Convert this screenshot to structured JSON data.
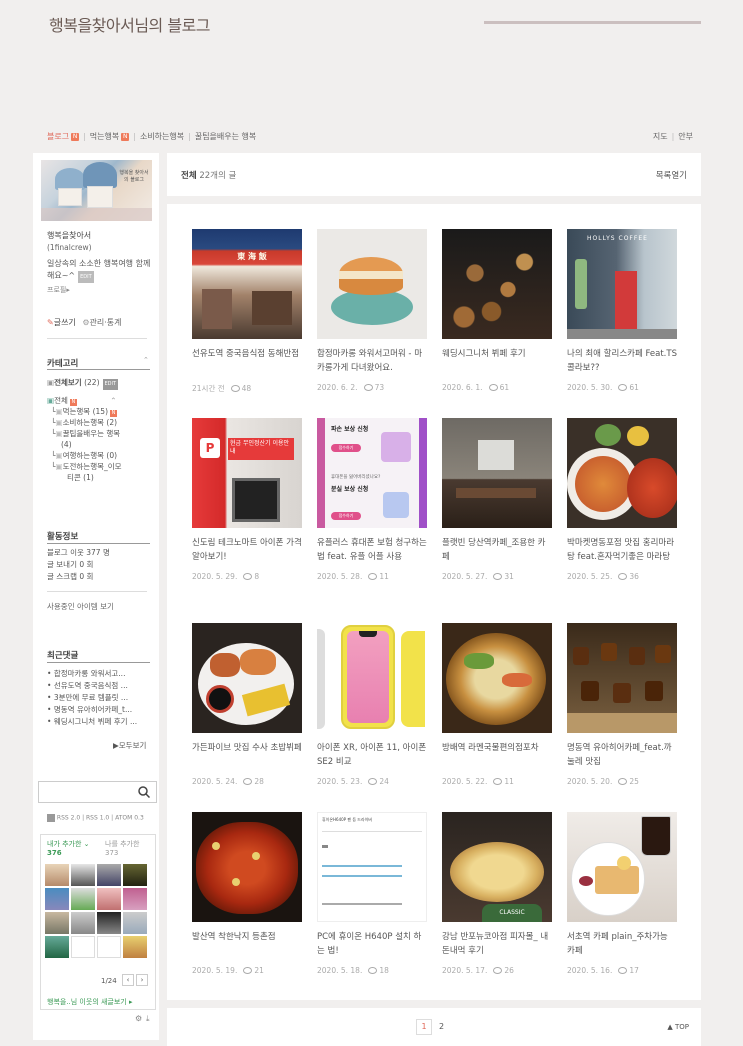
{
  "blog": {
    "title": "행복을찾아서님의 블로그"
  },
  "nav": {
    "items": [
      {
        "label": "블로그",
        "badge": "N",
        "active": true
      },
      {
        "label": "먹는행복",
        "badge": "N"
      },
      {
        "label": "소비하는행복",
        "badge": ""
      },
      {
        "label": "꿀팁을배우는 행복",
        "badge": ""
      }
    ],
    "right": [
      "지도",
      "안부"
    ]
  },
  "profile": {
    "name": "행복을찾아서",
    "id": "(1finalcrew)",
    "desc": "일상속의 소소한 행복여행 함께 해요~^",
    "desc_badge": "EDIT",
    "link": "프로필▸",
    "write": "글쓰기",
    "manage": "관리·통계",
    "img_text": "행복을 찾아서의 블로그"
  },
  "category": {
    "title": "카테고리",
    "all": "전체보기",
    "all_count": "(22)",
    "all_badge": "EDIT",
    "items": [
      {
        "label": "전체",
        "badge": "N"
      },
      {
        "label": "먹는행복 (15)",
        "badge": "N"
      },
      {
        "label": "소비하는행복 (2)"
      },
      {
        "label": "꿀팁을배우는 행복"
      },
      {
        "label": "(4)"
      },
      {
        "label": "여행하는행복 (0)"
      },
      {
        "label": "도전하는행복_이모"
      },
      {
        "label": "티콘 (1)"
      }
    ]
  },
  "activity": {
    "title": "활동정보",
    "rows": [
      "블로그 이웃 377 명",
      "글 보내기 0 회",
      "글 스크랩 0 회"
    ],
    "items_link": "사용중인 아이템 보기"
  },
  "recent": {
    "title": "최근댓글",
    "items": [
      "합정마카롱 와워서고...",
      "선유도역 중국음식점 ...",
      "3분만에 무료 템플릿 ...",
      "명동역 유아히어카페_t...",
      "웨딩시그니처 뷔페 후기 ..."
    ],
    "more": "▶모두보기"
  },
  "rss": {
    "items": [
      "RSS 2.0",
      "RSS 1.0",
      "ATOM 0.3"
    ]
  },
  "neighbors": {
    "tab_added": "내가 추가한",
    "added_count": "376",
    "tab_addedme": "나를 추가한",
    "addedme_count": "373",
    "page": "1/24",
    "footer": "행복을..님 이웃의 새글보기 ▸"
  },
  "list": {
    "label": "전체",
    "count": "22개의 글",
    "toggle": "목록열기"
  },
  "posts": [
    {
      "title": "선유도역 중국음식점 동해반점",
      "date": "21시간 전",
      "comments": "48"
    },
    {
      "title": "합정마카롱 와워서고머워 - 마카롱가게 다녀왔어요.",
      "date": "2020. 6. 2.",
      "comments": "73"
    },
    {
      "title": "웨딩시그니처 뷔페 후기",
      "date": "2020. 6. 1.",
      "comments": "61"
    },
    {
      "title": "나의 최애 할리스카페 Feat.TS 콜라보??",
      "date": "2020. 5. 30.",
      "comments": "61"
    },
    {
      "title": "신도림 테크노마트 아이폰 가격 알아보기!",
      "date": "2020. 5. 29.",
      "comments": "8"
    },
    {
      "title": "유플러스 휴대폰 보험 청구하는법 feat. 유플 어플 사용",
      "date": "2020. 5. 28.",
      "comments": "11"
    },
    {
      "title": "플랫빈 당산역카페_조용한 카페",
      "date": "2020. 5. 27.",
      "comments": "31"
    },
    {
      "title": "박마켓명동포점 맛집 홍리마라탕 feat.혼자먹기좋은 마라탕집",
      "date": "2020. 5. 25.",
      "comments": "36"
    },
    {
      "title": "가든파이브 맛집 수사 초밥뷔페",
      "date": "2020. 5. 24.",
      "comments": "28"
    },
    {
      "title": "아이폰 XR, 아이폰 11, 아이폰SE2 비교",
      "date": "2020. 5. 23.",
      "comments": "24"
    },
    {
      "title": "방배역 라멘국물편의점포차",
      "date": "2020. 5. 22.",
      "comments": "11"
    },
    {
      "title": "명동역 유아히어카페_feat.까눌레 맛집",
      "date": "2020. 5. 20.",
      "comments": "25"
    },
    {
      "title": "발산역 착한낙지 등촌점",
      "date": "2020. 5. 19.",
      "comments": "21"
    },
    {
      "title": "PC에 휴이온 H640P 설치 하는 법!",
      "date": "2020. 5. 18.",
      "comments": "18"
    },
    {
      "title": "강남 반포뉴코아점 피자몰_ 내돈내먹 후기",
      "date": "2020. 5. 17.",
      "comments": "26"
    },
    {
      "title": "서초역 카페 plain_주차가능 카페",
      "date": "2020. 5. 16.",
      "comments": "17"
    }
  ],
  "thumbs": {
    "sign": "東 海 飯",
    "phone_sign": "현금 무인정산기 이용안내",
    "shop_sign": "HOLLYS COFFEE",
    "uplus_1": "파손 보상 신청",
    "uplus_2": "휴대폰을 잃어버리셨나요?",
    "uplus_3": "분실 보상 신청",
    "uplus_btn": "접수하기",
    "doc_title": "휴이온H640P 펜 등 드라이버",
    "pizza": "CLASSIC"
  },
  "pagination": {
    "pages": [
      "1",
      "2"
    ],
    "current": "1",
    "top": "▲ TOP"
  }
}
